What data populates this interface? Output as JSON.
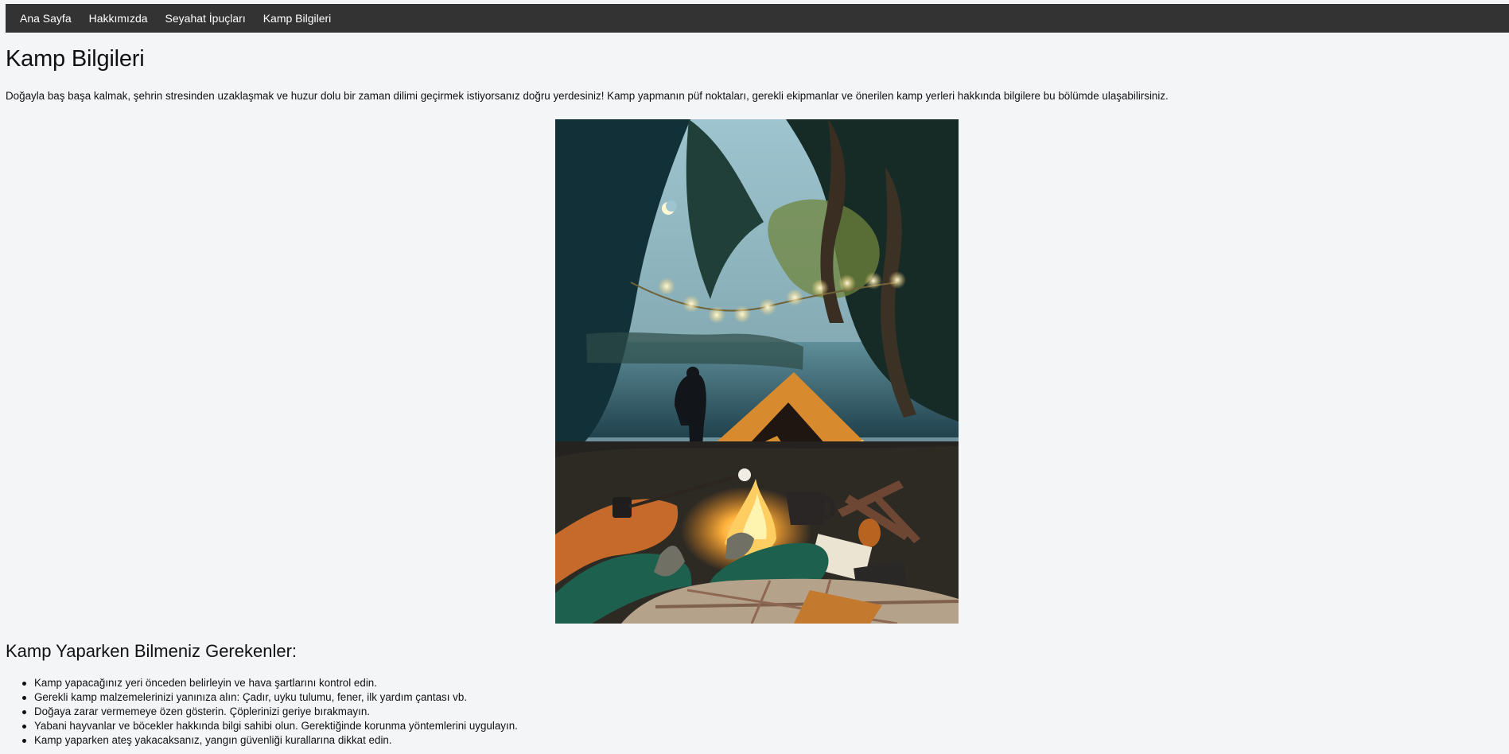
{
  "nav": {
    "items": [
      {
        "label": "Ana Sayfa"
      },
      {
        "label": "Hakkımızda"
      },
      {
        "label": "Seyahat İpuçları"
      },
      {
        "label": "Kamp Bilgileri"
      }
    ]
  },
  "main": {
    "title": "Kamp Bilgileri",
    "intro": "Doğayla baş başa kalmak, şehrin stresinden uzaklaşmak ve huzur dolu bir zaman dilimi geçirmek istiyorsanız doğru yerdesiniz! Kamp yapmanın püf noktaları, gerekli ekipmanlar ve önerilen kamp yerleri hakkında bilgilere bu bölümde ulaşabilirsiniz.",
    "section_title": "Kamp Yaparken Bilmeniz Gerekenler:",
    "tips": [
      "Kamp yapacağınız yeri önceden belirleyin ve hava şartlarını kontrol edin.",
      "Gerekli kamp malzemelerinizi yanınıza alın: Çadır, uyku tulumu, fener, ilk yardım çantası vb.",
      "Doğaya zarar vermemeye özen gösterin. Çöplerinizi geriye bırakmayın.",
      "Yabani hayvanlar ve böcekler hakkında bilgi sahibi olun. Gerektiğinde korunma yöntemlerini uygulayın.",
      "Kamp yaparken ateş yakacaksanız, yangın güvenliği kurallarına dikkat edin."
    ]
  }
}
